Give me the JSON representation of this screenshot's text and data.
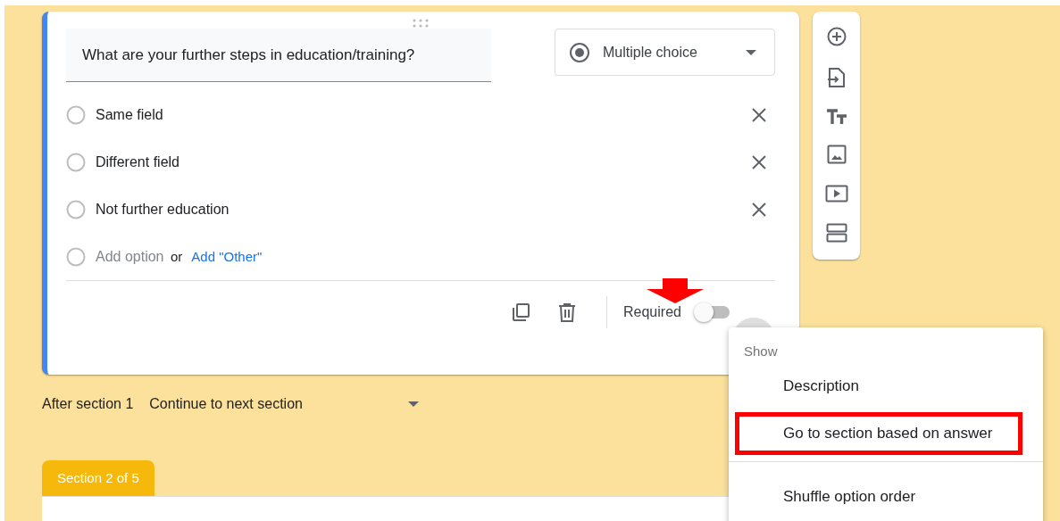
{
  "question": {
    "text": "What are your further steps in education/training?"
  },
  "question_type": {
    "label": "Multiple choice"
  },
  "options": [
    {
      "label": "Same field",
      "checked": false
    },
    {
      "label": "Different field",
      "checked": false
    },
    {
      "label": "Not further education",
      "checked": false
    }
  ],
  "add_option": {
    "checked": false,
    "placeholder": "Add option",
    "separator": "or",
    "link": "Add \"Other\""
  },
  "footer": {
    "required_label": "Required",
    "required_on": false
  },
  "after_section": {
    "label": "After section 1",
    "value": "Continue to next section"
  },
  "section_tab": {
    "label": "Section 2 of 5"
  },
  "pointer_arrow": true,
  "menu": {
    "heading": "Show",
    "items": [
      {
        "label": "Description",
        "divider_before": false,
        "highlighted": false
      },
      {
        "label": "Go to section based on answer",
        "divider_before": false,
        "highlighted": true
      },
      {
        "label": "Shuffle option order",
        "divider_before": true,
        "highlighted": false
      }
    ]
  }
}
